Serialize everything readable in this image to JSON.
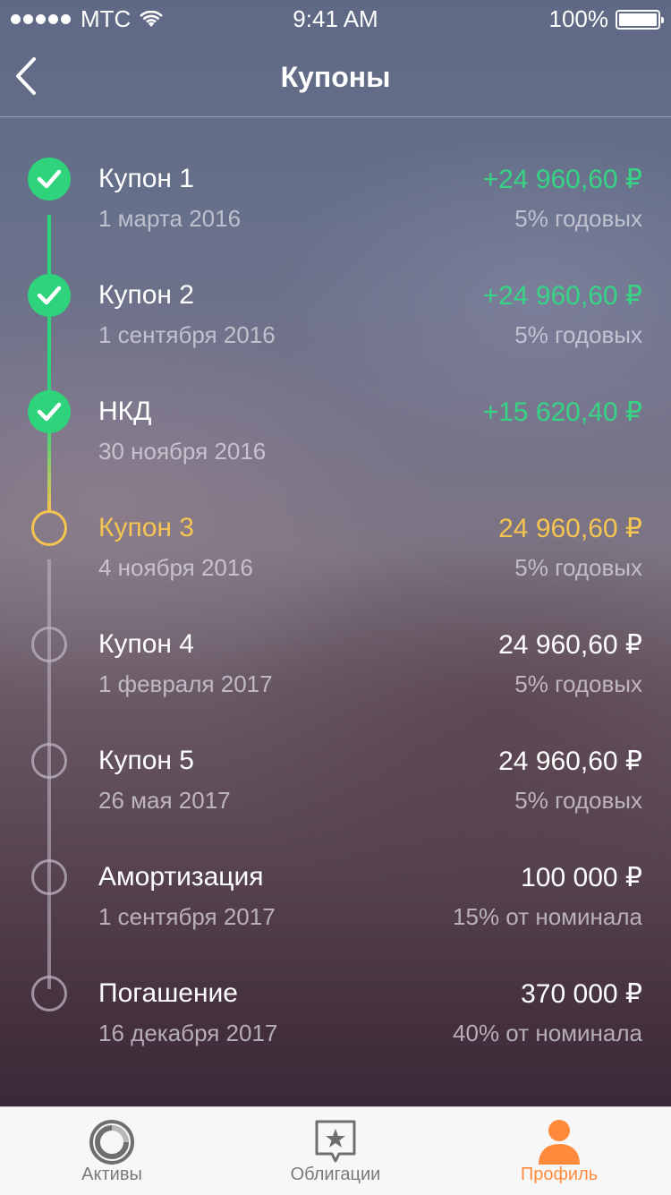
{
  "status_bar": {
    "carrier": "МТС",
    "time": "9:41 AM",
    "battery": "100%"
  },
  "nav": {
    "title": "Купоны",
    "back_icon": "chevron-left-icon"
  },
  "timeline": [
    {
      "title": "Купон 1",
      "date": "1 марта 2016",
      "amount": "+24 960,60 ₽",
      "rate": "5% годовых",
      "state": "done"
    },
    {
      "title": "Купон 2",
      "date": "1 сентября 2016",
      "amount": "+24 960,60 ₽",
      "rate": "5% годовых",
      "state": "done"
    },
    {
      "title": "НКД",
      "date": "30 ноября 2016",
      "amount": "+15 620,40 ₽",
      "rate": "",
      "state": "done"
    },
    {
      "title": "Купон 3",
      "date": "4 ноября 2016",
      "amount": "24 960,60 ₽",
      "rate": "5% годовых",
      "state": "next"
    },
    {
      "title": "Купон 4",
      "date": "1 февраля 2017",
      "amount": "24 960,60 ₽",
      "rate": "5% годовых",
      "state": "future"
    },
    {
      "title": "Купон 5",
      "date": "26 мая 2017",
      "amount": "24 960,60 ₽",
      "rate": "5% годовых",
      "state": "future"
    },
    {
      "title": "Амортизация",
      "date": "1 сентября 2017",
      "amount": "100 000 ₽",
      "rate": "15% от номинала",
      "state": "future"
    },
    {
      "title": "Погашение",
      "date": "16 декабря 2017",
      "amount": "370 000 ₽",
      "rate": "40% от номинала",
      "state": "future"
    }
  ],
  "tabs": [
    {
      "label": "Активы",
      "icon": "assets-ring-icon",
      "active": false
    },
    {
      "label": "Облигации",
      "icon": "bonds-star-icon",
      "active": false
    },
    {
      "label": "Профиль",
      "icon": "profile-icon",
      "active": true
    }
  ],
  "colors": {
    "done": "#2ed37c",
    "next": "#f5c451",
    "future": "#bdb4c3",
    "active_tab": "#ff8a3c"
  }
}
